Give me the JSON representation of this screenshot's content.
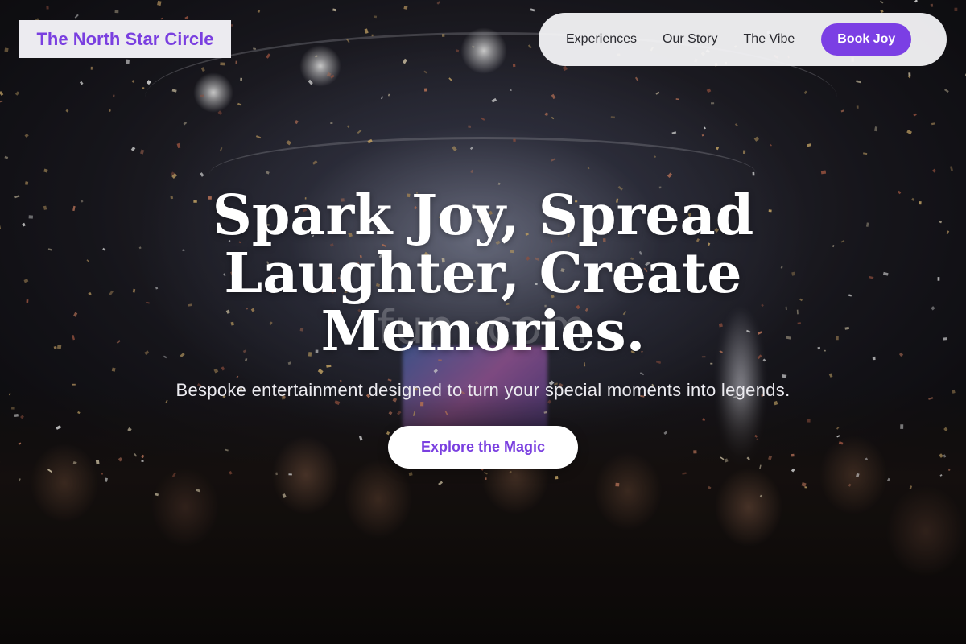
{
  "brand": {
    "name": "The North Star Circle",
    "accent_color": "#7b3fe4"
  },
  "nav": {
    "links": [
      "Experiences",
      "Our Story",
      "The Vibe"
    ],
    "cta_label": "Book Joy"
  },
  "hero": {
    "headline_lines": [
      "Spark Joy, Spread",
      "Laughter, Create",
      "Memories."
    ],
    "subheadline": "Bespoke entertainment designed to turn your special moments into legends.",
    "cta_label": "Explore the Magic",
    "background": "concert-crowd-confetti-photo"
  },
  "watermark": {
    "text": "fun           .com"
  }
}
